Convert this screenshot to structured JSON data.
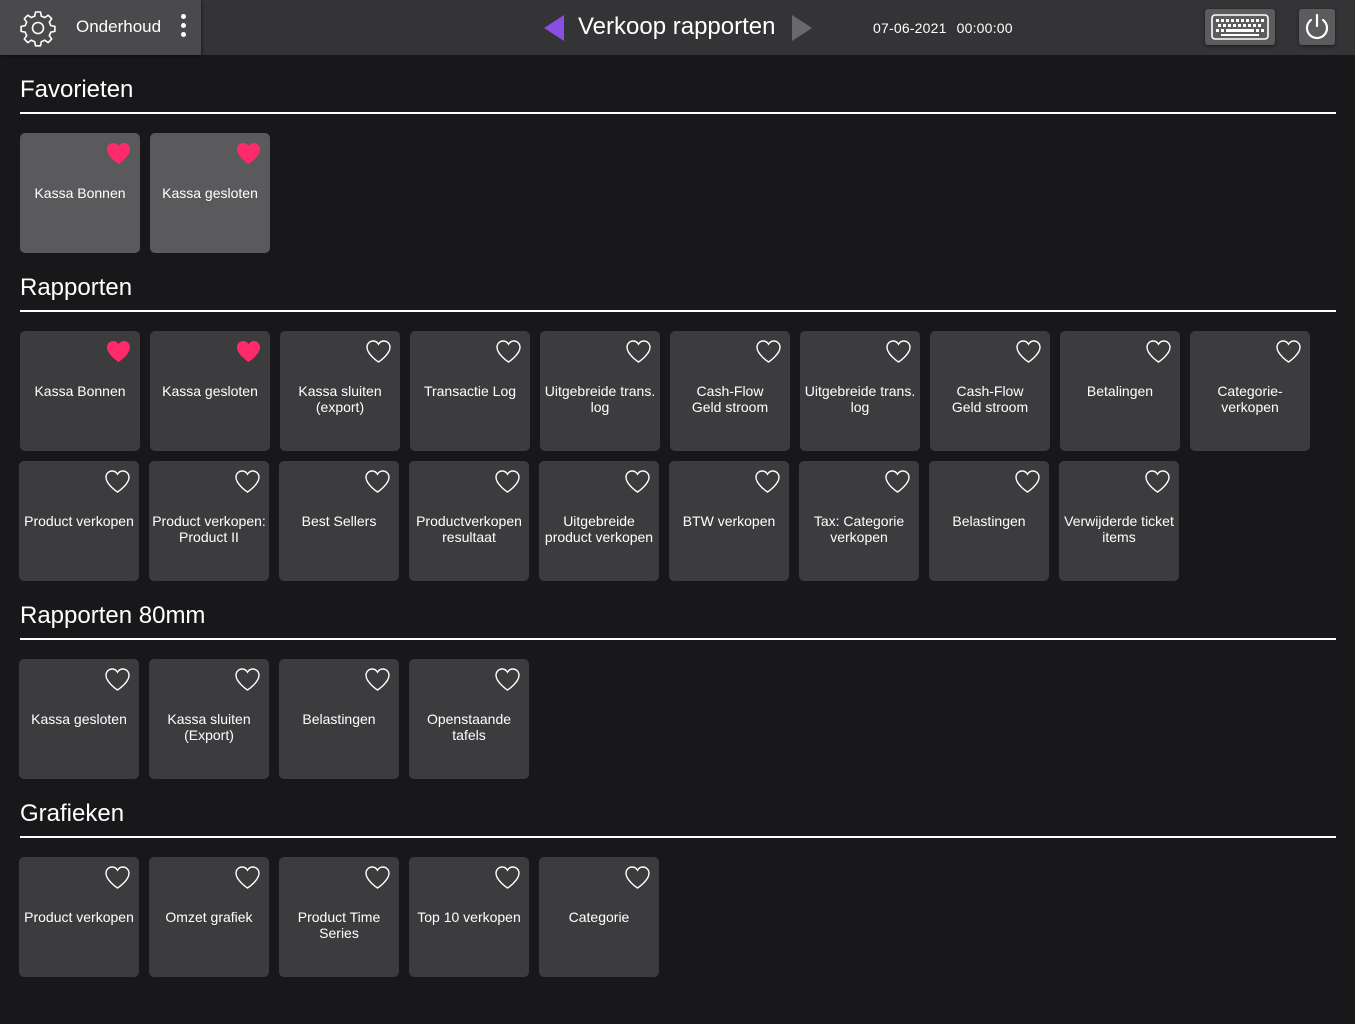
{
  "header": {
    "menu_label": "Onderhoud",
    "title": "Verkoop rapporten",
    "date": "07-06-2021",
    "time": "00:00:00",
    "accent_color": "#8a4fe0"
  },
  "sections": {
    "favorieten": {
      "title": "Favorieten",
      "tiles": [
        {
          "label": "Kassa Bonnen",
          "favorite": true
        },
        {
          "label": "Kassa gesloten",
          "favorite": true
        }
      ]
    },
    "rapporten": {
      "title": "Rapporten",
      "tiles": [
        {
          "label": "Kassa Bonnen",
          "favorite": true
        },
        {
          "label": "Kassa gesloten",
          "favorite": true
        },
        {
          "label": "Kassa sluiten\n(export)",
          "favorite": false
        },
        {
          "label": "Transactie Log",
          "favorite": false
        },
        {
          "label": "Uitgebreide trans.\nlog",
          "favorite": false
        },
        {
          "label": "Cash-Flow\nGeld stroom",
          "favorite": false
        },
        {
          "label": "Uitgebreide trans.\nlog",
          "favorite": false
        },
        {
          "label": "Cash-Flow\nGeld stroom",
          "favorite": false
        },
        {
          "label": "Betalingen",
          "favorite": false
        },
        {
          "label": "Categorie-\nverkopen",
          "favorite": false
        },
        {
          "label": "Product verkopen",
          "favorite": false
        },
        {
          "label": "Product verkopen:\nProduct II",
          "favorite": false
        },
        {
          "label": "Best Sellers",
          "favorite": false
        },
        {
          "label": "Productverkopen\nresultaat",
          "favorite": false
        },
        {
          "label": "Uitgebreide\nproduct verkopen",
          "favorite": false
        },
        {
          "label": "BTW verkopen",
          "favorite": false
        },
        {
          "label": "Tax: Categorie\nverkopen",
          "favorite": false
        },
        {
          "label": "Belastingen",
          "favorite": false
        },
        {
          "label": "Verwijderde ticket\nitems",
          "favorite": false
        }
      ]
    },
    "rapporten80": {
      "title": "Rapporten 80mm",
      "tiles": [
        {
          "label": "Kassa gesloten",
          "favorite": false
        },
        {
          "label": "Kassa sluiten\n(Export)",
          "favorite": false
        },
        {
          "label": "Belastingen",
          "favorite": false
        },
        {
          "label": "Openstaande\ntafels",
          "favorite": false
        }
      ]
    },
    "grafieken": {
      "title": "Grafieken",
      "tiles": [
        {
          "label": "Product verkopen",
          "favorite": false
        },
        {
          "label": "Omzet grafiek",
          "favorite": false
        },
        {
          "label": "Product Time\nSeries",
          "favorite": false
        },
        {
          "label": "Top 10 verkopen",
          "favorite": false
        },
        {
          "label": "Categorie",
          "favorite": false
        }
      ]
    }
  },
  "colors": {
    "heart_active": "#ff2a6a",
    "heart_outline": "#ffffff"
  }
}
